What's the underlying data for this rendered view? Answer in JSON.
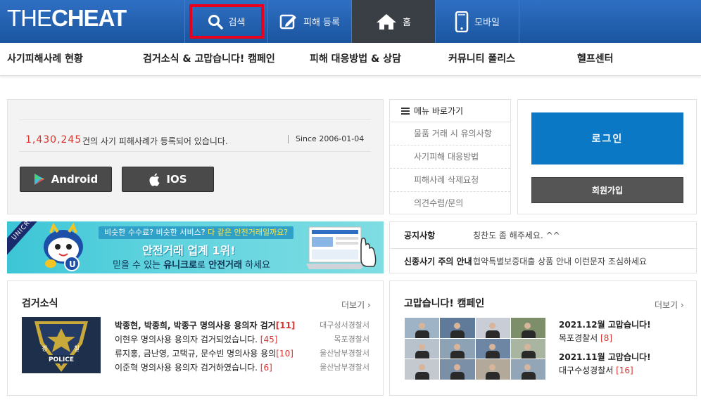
{
  "header": {
    "logo_part1": "THE",
    "logo_part2": "CHEAT",
    "nav": [
      {
        "label": "검색",
        "icon": "search-icon"
      },
      {
        "label": "피해 등록",
        "icon": "edit-icon"
      },
      {
        "label": "홈",
        "icon": "home-icon"
      },
      {
        "label": "모바일",
        "icon": "mobile-icon"
      }
    ]
  },
  "subnav": [
    "사기피해사례 현황",
    "검거소식 & 고맙습니다! 캠페인",
    "피해 대응방법 & 상담",
    "커뮤니티 폴리스",
    "헬프센터"
  ],
  "stats": {
    "count": "1,430,245",
    "count_suffix": "건의 사기 피해사례가 등록되어 있습니다.",
    "since": "Since 2006-01-04",
    "android_label": "Android",
    "ios_label": "IOS"
  },
  "quick_menu": {
    "title": "메뉴 바로가기",
    "items": [
      "물품 거래 시 유의사항",
      "사기피해 대응방법",
      "피해사례 삭제요청",
      "의견수렴/문의"
    ]
  },
  "login": {
    "login_label": "로그인",
    "join_label": "회원가입"
  },
  "banner": {
    "corner": "UNICRO",
    "top_line_a": "비슷한 수수료? 비슷한 서비스? ",
    "top_line_b": "다 같은 안전거래일까요?",
    "main": "안전거래 업계 1위!",
    "sub_a": "믿을 수 있는 ",
    "sub_b": "유니크로",
    "sub_c": "로 ",
    "sub_d": "안전거래",
    "sub_e": " 하세요"
  },
  "notice": [
    {
      "label": "공지사항",
      "text": "칭찬도 좀 해주세요. ^^"
    },
    {
      "label": "신종사기 주의 안내",
      "text": "협약특별보증대출 상품 안내 이런문자 조심하세요"
    }
  ],
  "arrests": {
    "title": "검거소식",
    "more": "더보기 ›",
    "image_text": "POLICE",
    "emblem_left": "경",
    "emblem_right": "찰",
    "items": [
      {
        "title": "박종현, 박종희, 박종구 명의사용 용의자 검거",
        "count": "[11]",
        "station": "대구성서경찰서",
        "bold": true
      },
      {
        "title": "이현우 명의사용 용의자 검거되었습니다.",
        "count": "[45]",
        "station": "목포경찰서",
        "bold": false
      },
      {
        "title": "류지홍, 금난영, 고택규, 문수빈 명의사용 용의",
        "count": "[10]",
        "station": "울산남부경찰서",
        "bold": false
      },
      {
        "title": "이준혁 명의사용 용의자 검거하였습니다.",
        "count": "[6]",
        "station": "울산남부경찰서",
        "bold": false
      }
    ]
  },
  "campaign": {
    "title": "고맙습니다! 캠페인",
    "more": "더보기 ›",
    "items": [
      {
        "title": "2021.12월 고맙습니다!",
        "station": "목포경찰서",
        "count": "[8]"
      },
      {
        "title": "2021.11월 고맙습니다!",
        "station": "대구수성경찰서",
        "count": "[16]"
      }
    ]
  }
}
